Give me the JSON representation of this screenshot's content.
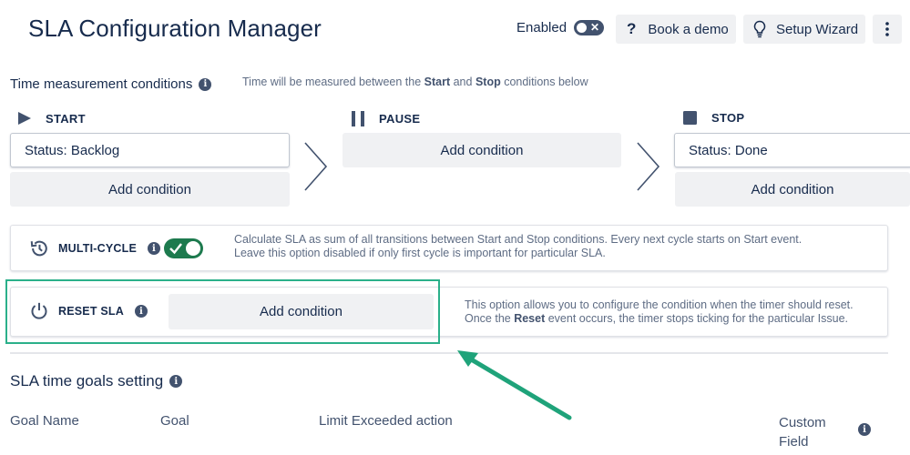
{
  "header": {
    "title": "SLA Configuration Manager",
    "enabled_label": "Enabled",
    "book_demo_label": "Book a demo",
    "setup_wizard_label": "Setup Wizard"
  },
  "time_measurement": {
    "title": "Time measurement conditions",
    "description_pre": "Time will be measured between the ",
    "description_start": "Start",
    "description_and": " and ",
    "description_stop": "Stop",
    "description_post": " conditions below",
    "start": {
      "label": "START",
      "condition": "Status: Backlog",
      "add_label": "Add condition"
    },
    "pause": {
      "label": "PAUSE",
      "add_label": "Add condition"
    },
    "stop": {
      "label": "STOP",
      "condition": "Status: Done",
      "add_label": "Add condition"
    }
  },
  "multi_cycle": {
    "label": "MULTI-CYCLE",
    "enabled": true,
    "description_line1": "Calculate SLA as sum of all transitions between Start and Stop conditions. Every next cycle starts on Start event.",
    "description_line2": "Leave this option disabled if only first cycle is important for particular SLA."
  },
  "reset_sla": {
    "label": "RESET SLA",
    "add_label": "Add condition",
    "description_line1": "This option allows you to configure the condition when the timer should reset.",
    "description_line2_pre": "Once the ",
    "description_line2_bold": "Reset",
    "description_line2_post": " event occurs, the timer stops ticking for the particular Issue."
  },
  "goals": {
    "title": "SLA time goals setting",
    "columns": [
      "Goal Name",
      "Goal",
      "Limit Exceeded action",
      "Custom",
      "Field"
    ]
  },
  "colors": {
    "accent_green": "#1d7a4e",
    "highlight_border": "#2bb08a",
    "arrow": "#1fa37a",
    "text_dark": "#172b4d",
    "button_grey": "#f0f1f3"
  }
}
